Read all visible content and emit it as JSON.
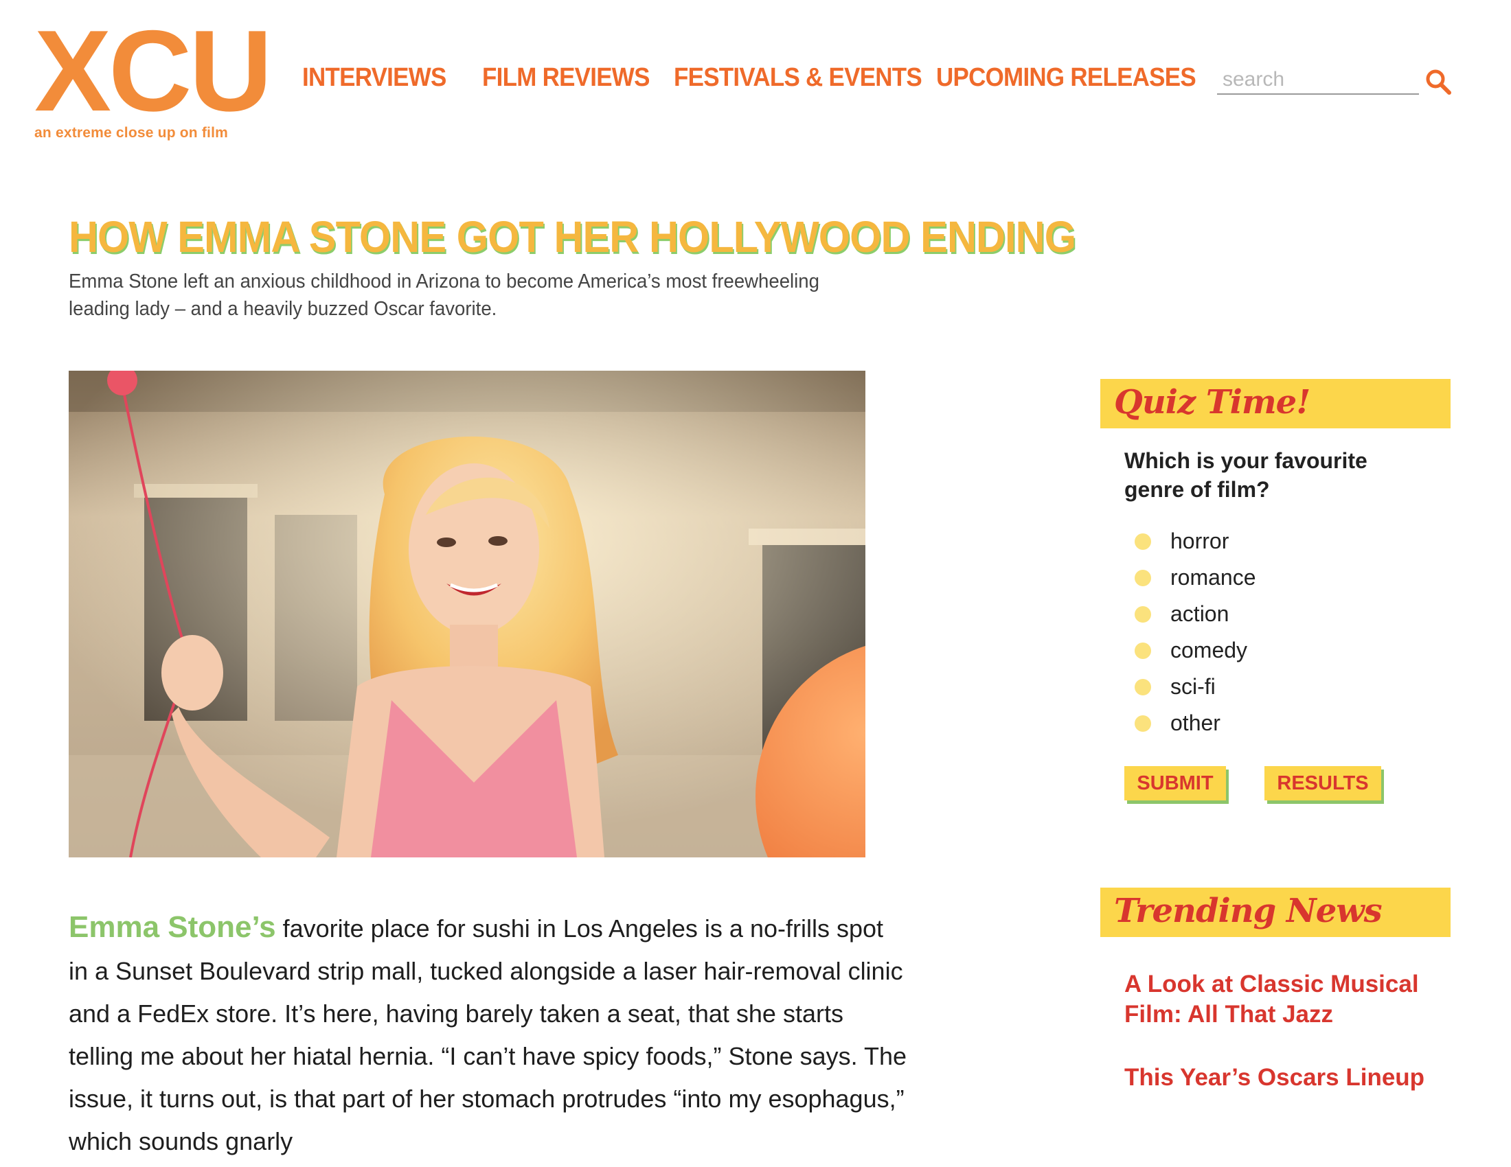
{
  "logo": {
    "text": "XCU",
    "tagline": "an extreme close up on film"
  },
  "nav": {
    "items": [
      {
        "label": "INTERVIEWS"
      },
      {
        "label": "FILM REVIEWS"
      },
      {
        "label": "FESTIVALS & EVENTS"
      },
      {
        "label": "UPCOMING RELEASES"
      }
    ]
  },
  "search": {
    "placeholder": "search",
    "icon": "search-icon"
  },
  "article": {
    "headline": "HOW EMMA STONE GOT HER HOLLYWOOD ENDING",
    "subhead": "Emma Stone left an anxious childhood in Arizona to become America’s most freewheeling leading lady – and a heavily buzzed Oscar favorite.",
    "lead_name": "Emma Stone’s",
    "body": " favorite place for sushi in Los Angeles is a no-frills spot in a Sunset Boulevard strip mall, tucked alongside a laser hair-removal clinic and a FedEx store. It’s here, having barely taken a seat, that she starts telling me about her hiatal hernia. “I can’t have spicy foods,” Stone says. The issue, it turns out, is that part of her stomach protrudes “into my esophagus,” which sounds gnarly"
  },
  "quiz": {
    "title": "Quiz Time!",
    "question": "Which is your favourite genre of film?",
    "options": [
      "horror",
      "romance",
      "action",
      "comedy",
      "sci-fi",
      "other"
    ],
    "submit_label": "SUBMIT",
    "results_label": "RESULTS"
  },
  "trending": {
    "title": "Trending News",
    "items": [
      "A Look at Classic Musical Film: All That Jazz",
      "This Year’s Oscars Lineup"
    ]
  },
  "colors": {
    "brand_orange": "#f28c3a",
    "headline_yellow": "#f5b73f",
    "accent_green": "#8cc56a",
    "sidebar_yellow": "#fcd64b",
    "link_red": "#d8362e"
  }
}
